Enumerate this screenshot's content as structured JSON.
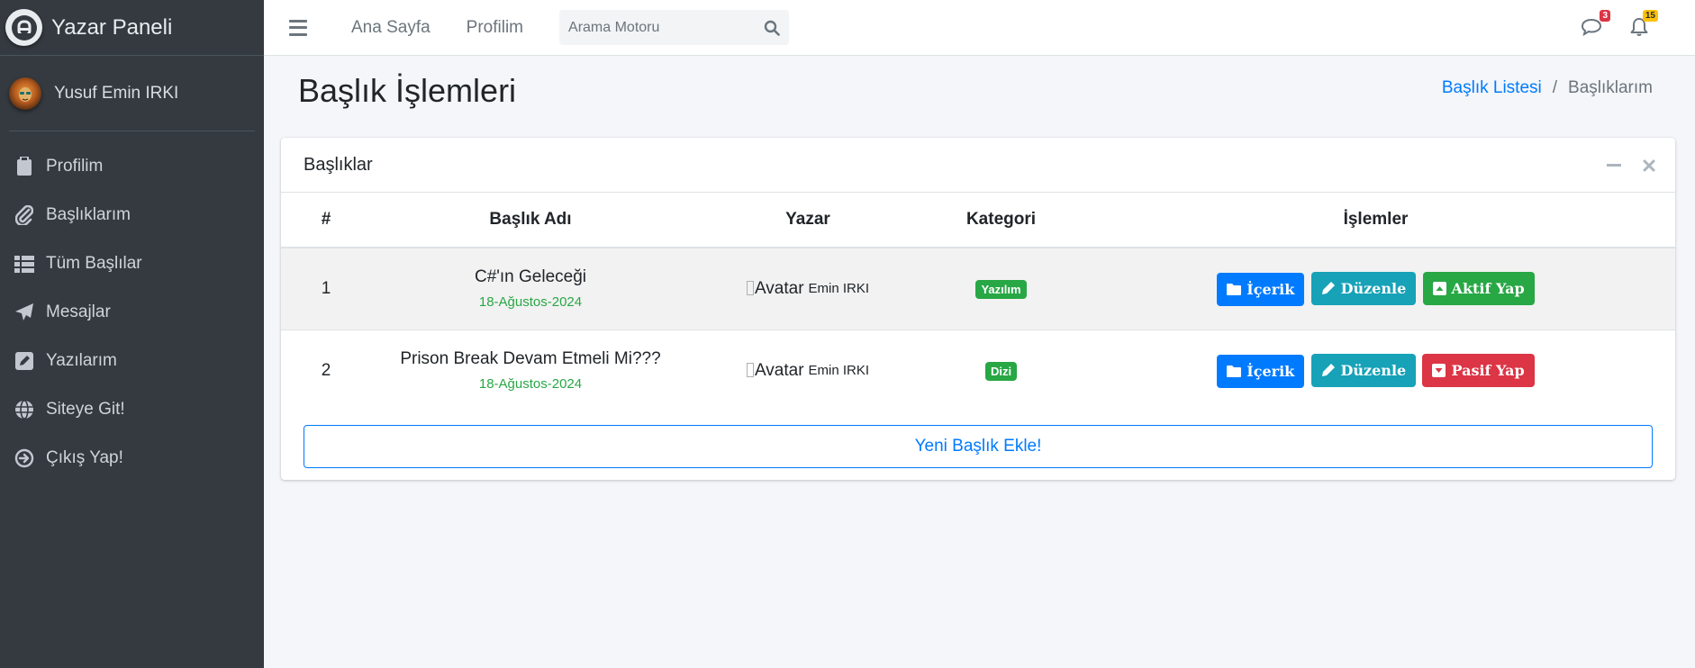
{
  "brand": {
    "title": "Yazar Paneli",
    "logo_icon": "panel-logo-icon"
  },
  "user": {
    "name": "Yusuf Emin IRKI",
    "avatar_icon": "lion-avatar-icon"
  },
  "sidebar": {
    "items": [
      {
        "label": "Profilim",
        "icon": "clipboard-icon"
      },
      {
        "label": "Başlıklarım",
        "icon": "paperclip-icon"
      },
      {
        "label": "Tüm Başlılar",
        "icon": "table-list-icon"
      },
      {
        "label": "Mesajlar",
        "icon": "paper-plane-icon"
      },
      {
        "label": "Yazılarım",
        "icon": "edit-square-icon"
      },
      {
        "label": "Siteye Git!",
        "icon": "globe-icon"
      },
      {
        "label": "Çıkış Yap!",
        "icon": "arrow-circle-right-icon"
      }
    ]
  },
  "topbar": {
    "links": [
      "Ana Sayfa",
      "Profilim"
    ],
    "search_placeholder": "Arama Motoru",
    "messages_count": "3",
    "notifications_count": "15"
  },
  "page": {
    "title": "Başlık İşlemleri",
    "breadcrumb": {
      "link": "Başlık Listesi",
      "separator": "/",
      "active": "Başlıklarım"
    }
  },
  "card": {
    "title": "Başlıklar",
    "columns": [
      "#",
      "Başlık Adı",
      "Yazar",
      "Kategori",
      "İşlemler"
    ],
    "rows": [
      {
        "num": "1",
        "title": "C#'ın Geleceği",
        "date": "18-Ağustos-2024",
        "avatar_alt": "Avatar",
        "author": "Emin IRKI",
        "category": "Yazılım",
        "btn_content": "İçerik",
        "btn_edit": "Düzenle",
        "btn_status": "Aktif Yap"
      },
      {
        "num": "2",
        "title": "Prison Break Devam Etmeli Mi???",
        "date": "18-Ağustos-2024",
        "avatar_alt": "Avatar",
        "author": "Emin IRKI",
        "category": "Dizi",
        "btn_content": "İçerik",
        "btn_edit": "Düzenle",
        "btn_status": "Pasif Yap"
      }
    ],
    "add_button": "Yeni Başlık Ekle!"
  },
  "colors": {
    "sidebar_bg": "#343a40",
    "primary": "#007bff",
    "info": "#17a2b8",
    "success": "#28a745",
    "danger": "#dc3545",
    "warning": "#ffc107"
  }
}
